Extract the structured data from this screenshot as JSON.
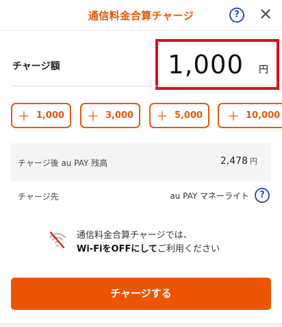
{
  "header": {
    "title": "通信料金合算チャージ",
    "help_glyph": "?",
    "close_glyph": "✕"
  },
  "amount": {
    "label": "チャージ額",
    "value": "1,000",
    "unit": "円"
  },
  "presets": [
    {
      "plus": "＋",
      "label": "1,000"
    },
    {
      "plus": "＋",
      "label": "3,000"
    },
    {
      "plus": "＋",
      "label": "5,000"
    },
    {
      "plus": "＋",
      "label": "10,000"
    }
  ],
  "balance": {
    "label": "チャージ後 au PAY 残高",
    "value": "2,478",
    "unit": "円"
  },
  "destination": {
    "label": "チャージ先",
    "value": "au PAY マネーライト",
    "help_glyph": "?"
  },
  "wifi_notice": {
    "line1": "通信料金合算チャージでは、",
    "line2_bold": "Wi-FiをOFFにして",
    "line2_rest": "ご利用ください"
  },
  "charge_button": {
    "label": "チャージする"
  },
  "colors": {
    "accent": "#eb5505",
    "help_blue": "#2b4fbd",
    "highlight_red": "#d9121c"
  }
}
